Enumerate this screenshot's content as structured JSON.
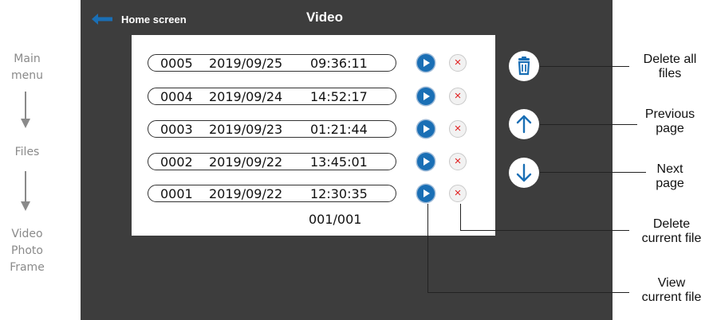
{
  "nav_path": {
    "main_menu": [
      "Main",
      "menu"
    ],
    "files": "Files",
    "targets": [
      "Video",
      "Photo",
      "Frame"
    ]
  },
  "screen": {
    "back_label": "Home screen",
    "title": "Video",
    "files": [
      {
        "number": "0005",
        "date": "2019/09/25",
        "time": "09:36:11"
      },
      {
        "number": "0004",
        "date": "2019/09/24",
        "time": "14:52:17"
      },
      {
        "number": "0003",
        "date": "2019/09/23",
        "time": "01:21:44"
      },
      {
        "number": "0002",
        "date": "2019/09/22",
        "time": "13:45:01"
      },
      {
        "number": "0001",
        "date": "2019/09/22",
        "time": "12:30:35"
      }
    ],
    "page_indicator": "001/001",
    "delete_glyph": "×"
  },
  "callouts": {
    "delete_all": [
      "Delete all",
      "files"
    ],
    "previous_page": [
      "Previous",
      "page"
    ],
    "next_page": [
      "Next",
      "page"
    ],
    "delete_current": [
      "Delete",
      "current file"
    ],
    "view_current": [
      "View",
      "current file"
    ]
  },
  "icons": {
    "back": "back-arrow-icon",
    "play": "play-icon",
    "delete": "close-icon",
    "delete_all": "trash-icon",
    "previous": "arrow-up-icon",
    "next": "arrow-down-icon"
  },
  "colors": {
    "screen_bg": "#3d3d3d",
    "accent_blue": "#1a6fb5",
    "delete_red": "#e02020",
    "nav_gray": "#8a8a8a"
  }
}
